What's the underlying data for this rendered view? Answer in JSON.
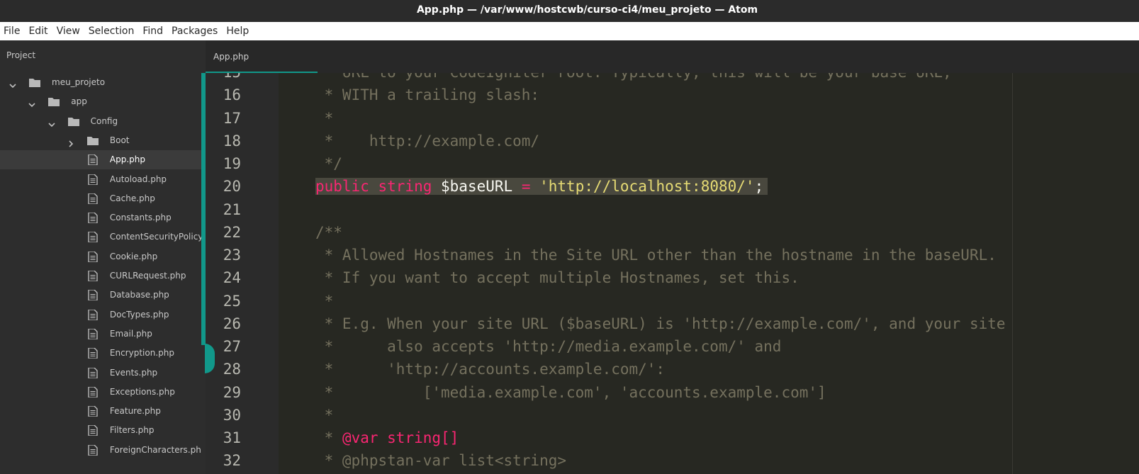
{
  "window": {
    "title": "App.php — /var/www/hostcwb/curso-ci4/meu_projeto — Atom"
  },
  "menu": [
    "File",
    "Edit",
    "View",
    "Selection",
    "Find",
    "Packages",
    "Help"
  ],
  "tree": {
    "title": "Project",
    "items": [
      {
        "label": "meu_projeto",
        "type": "folder",
        "expanded": true,
        "depth": 0
      },
      {
        "label": "app",
        "type": "folder",
        "expanded": true,
        "depth": 1
      },
      {
        "label": "Config",
        "type": "folder",
        "expanded": true,
        "depth": 2
      },
      {
        "label": "Boot",
        "type": "folder",
        "expanded": false,
        "depth": 3
      },
      {
        "label": "App.php",
        "type": "file",
        "selected": true,
        "depth": 3
      },
      {
        "label": "Autoload.php",
        "type": "file",
        "depth": 3
      },
      {
        "label": "Cache.php",
        "type": "file",
        "depth": 3
      },
      {
        "label": "Constants.php",
        "type": "file",
        "depth": 3
      },
      {
        "label": "ContentSecurityPolicy.php",
        "type": "file",
        "depth": 3
      },
      {
        "label": "Cookie.php",
        "type": "file",
        "depth": 3
      },
      {
        "label": "CURLRequest.php",
        "type": "file",
        "depth": 3
      },
      {
        "label": "Database.php",
        "type": "file",
        "depth": 3
      },
      {
        "label": "DocTypes.php",
        "type": "file",
        "depth": 3
      },
      {
        "label": "Email.php",
        "type": "file",
        "depth": 3
      },
      {
        "label": "Encryption.php",
        "type": "file",
        "depth": 3
      },
      {
        "label": "Events.php",
        "type": "file",
        "depth": 3
      },
      {
        "label": "Exceptions.php",
        "type": "file",
        "depth": 3
      },
      {
        "label": "Feature.php",
        "type": "file",
        "depth": 3
      },
      {
        "label": "Filters.php",
        "type": "file",
        "depth": 3
      },
      {
        "label": "ForeignCharacters.php",
        "type": "file",
        "depth": 3
      }
    ]
  },
  "tabs": [
    {
      "label": "App.php",
      "active": true
    }
  ],
  "editor": {
    "lines": [
      {
        "num": "15",
        "tokens": [
          {
            "t": " * URL to your CodeIgniter root. Typically, this will be your base URL,",
            "c": "cm"
          }
        ]
      },
      {
        "num": "16",
        "tokens": [
          {
            "t": " * WITH a trailing slash:",
            "c": "cm"
          }
        ]
      },
      {
        "num": "17",
        "tokens": [
          {
            "t": " *",
            "c": "cm"
          }
        ]
      },
      {
        "num": "18",
        "tokens": [
          {
            "t": " *    http://example.com/",
            "c": "cm"
          }
        ]
      },
      {
        "num": "19",
        "tokens": [
          {
            "t": " */",
            "c": "cm"
          }
        ]
      },
      {
        "num": "20",
        "current": true,
        "tokens": [
          {
            "t": "public",
            "c": "kw"
          },
          {
            "t": " ",
            "c": "pl"
          },
          {
            "t": "string",
            "c": "kw"
          },
          {
            "t": " $baseURL ",
            "c": "var"
          },
          {
            "t": "=",
            "c": "op"
          },
          {
            "t": " ",
            "c": "pl"
          },
          {
            "t": "'http://localhost:8080/'",
            "c": "str"
          },
          {
            "t": ";",
            "c": "pl"
          }
        ]
      },
      {
        "num": "21",
        "tokens": []
      },
      {
        "num": "22",
        "tokens": [
          {
            "t": "/**",
            "c": "cm"
          }
        ]
      },
      {
        "num": "23",
        "tokens": [
          {
            "t": " * Allowed Hostnames in the Site URL other than the hostname in the baseURL.",
            "c": "cm"
          }
        ]
      },
      {
        "num": "24",
        "tokens": [
          {
            "t": " * If you want to accept multiple Hostnames, set this.",
            "c": "cm"
          }
        ]
      },
      {
        "num": "25",
        "tokens": [
          {
            "t": " *",
            "c": "cm"
          }
        ]
      },
      {
        "num": "26",
        "tokens": [
          {
            "t": " * E.g. When your site URL ($baseURL) is 'http://example.com/', and your site",
            "c": "cm"
          }
        ]
      },
      {
        "num": "27",
        "tokens": [
          {
            "t": " *      also accepts 'http://media.example.com/' and",
            "c": "cm"
          }
        ]
      },
      {
        "num": "28",
        "tokens": [
          {
            "t": " *      'http://accounts.example.com/':",
            "c": "cm"
          }
        ]
      },
      {
        "num": "29",
        "tokens": [
          {
            "t": " *          ['media.example.com', 'accounts.example.com']",
            "c": "cm"
          }
        ]
      },
      {
        "num": "30",
        "tokens": [
          {
            "t": " *",
            "c": "cm"
          }
        ]
      },
      {
        "num": "31",
        "tokens": [
          {
            "t": " * ",
            "c": "cm"
          },
          {
            "t": "@var string[]",
            "c": "tag"
          }
        ]
      },
      {
        "num": "32",
        "tokens": [
          {
            "t": " * @phpstan-var list<string>",
            "c": "cm"
          }
        ]
      }
    ]
  }
}
